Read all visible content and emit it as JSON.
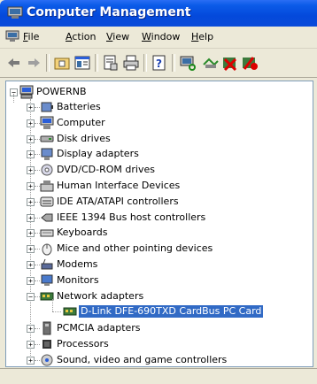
{
  "window": {
    "title": "Computer Management"
  },
  "menu": [
    {
      "label": "File",
      "u": "F",
      "rest": "ile"
    },
    {
      "label": "Action",
      "u": "A",
      "rest": "ction"
    },
    {
      "label": "View",
      "u": "V",
      "rest": "iew"
    },
    {
      "label": "Window",
      "u": "W",
      "rest": "indow"
    },
    {
      "label": "Help",
      "u": "H",
      "rest": "elp"
    }
  ],
  "toolbar": {
    "buttons": [
      "back-icon",
      "forward-icon",
      "up-level-icon",
      "show-hide-tree-icon",
      "properties-icon",
      "print-icon",
      "help-icon",
      "scan-hardware-icon",
      "update-driver-icon",
      "uninstall-icon",
      "disable-icon"
    ]
  },
  "tree": {
    "root": "POWERNB",
    "categories": [
      {
        "label": "Batteries",
        "icon": "battery-icon",
        "expanded": false
      },
      {
        "label": "Computer",
        "icon": "computer-icon",
        "expanded": false
      },
      {
        "label": "Disk drives",
        "icon": "disk-drive-icon",
        "expanded": false
      },
      {
        "label": "Display adapters",
        "icon": "display-adapter-icon",
        "expanded": false
      },
      {
        "label": "DVD/CD-ROM drives",
        "icon": "cdrom-icon",
        "expanded": false
      },
      {
        "label": "Human Interface Devices",
        "icon": "hid-icon",
        "expanded": false
      },
      {
        "label": "IDE ATA/ATAPI controllers",
        "icon": "ide-controller-icon",
        "expanded": false
      },
      {
        "label": "IEEE 1394 Bus host controllers",
        "icon": "ieee1394-icon",
        "expanded": false
      },
      {
        "label": "Keyboards",
        "icon": "keyboard-icon",
        "expanded": false
      },
      {
        "label": "Mice and other pointing devices",
        "icon": "mouse-icon",
        "expanded": false
      },
      {
        "label": "Modems",
        "icon": "modem-icon",
        "expanded": false
      },
      {
        "label": "Monitors",
        "icon": "monitor-icon",
        "expanded": false
      },
      {
        "label": "Network adapters",
        "icon": "network-adapter-icon",
        "expanded": true,
        "children": [
          {
            "label": "D-Link DFE-690TXD CardBus PC Card",
            "icon": "network-card-icon",
            "selected": true
          }
        ]
      },
      {
        "label": "PCMCIA adapters",
        "icon": "pcmcia-icon",
        "expanded": false
      },
      {
        "label": "Processors",
        "icon": "processor-icon",
        "expanded": false
      },
      {
        "label": "Sound, video and game controllers",
        "icon": "sound-icon",
        "expanded": false
      }
    ]
  },
  "colors": {
    "titlebar": "#0449db",
    "selection": "#316ac5",
    "face": "#ece9d8"
  }
}
